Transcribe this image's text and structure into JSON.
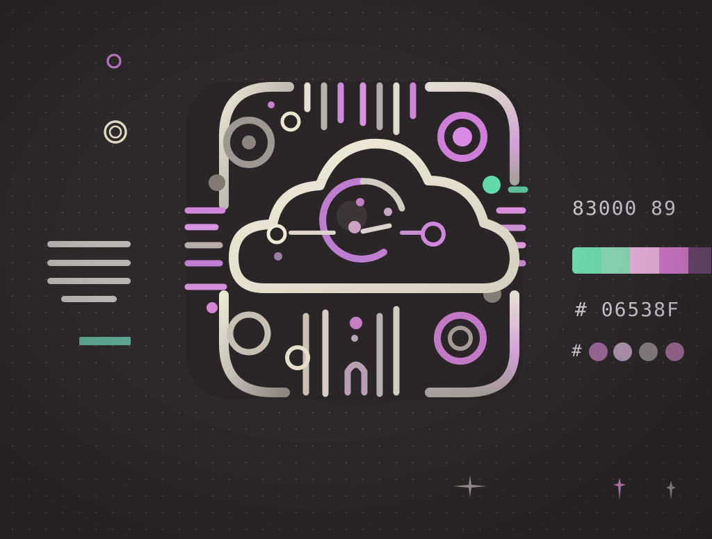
{
  "labels": {
    "number_text": "83000 89",
    "hex_text": "# 06538F",
    "dot_row_prefix": "#"
  },
  "colors": {
    "background": "#2e2a2c",
    "cream": "#e6dfcf",
    "stone": "#a19a93",
    "violet": "#c27fd8",
    "lavender": "#d79be6",
    "mint": "#62d9a9",
    "pink": "#e7a3da",
    "magenta": "#d67ad0",
    "plum": "#6a4b6d",
    "swatch_dots": [
      "#a06b9e",
      "#b69ab4",
      "#8e8487",
      "#a26c9a"
    ]
  },
  "icons": {
    "main_icon": "cloud-circuit-app-icon",
    "left_lines": "text-lines-icon",
    "sparkles": "sparkle-icon"
  }
}
